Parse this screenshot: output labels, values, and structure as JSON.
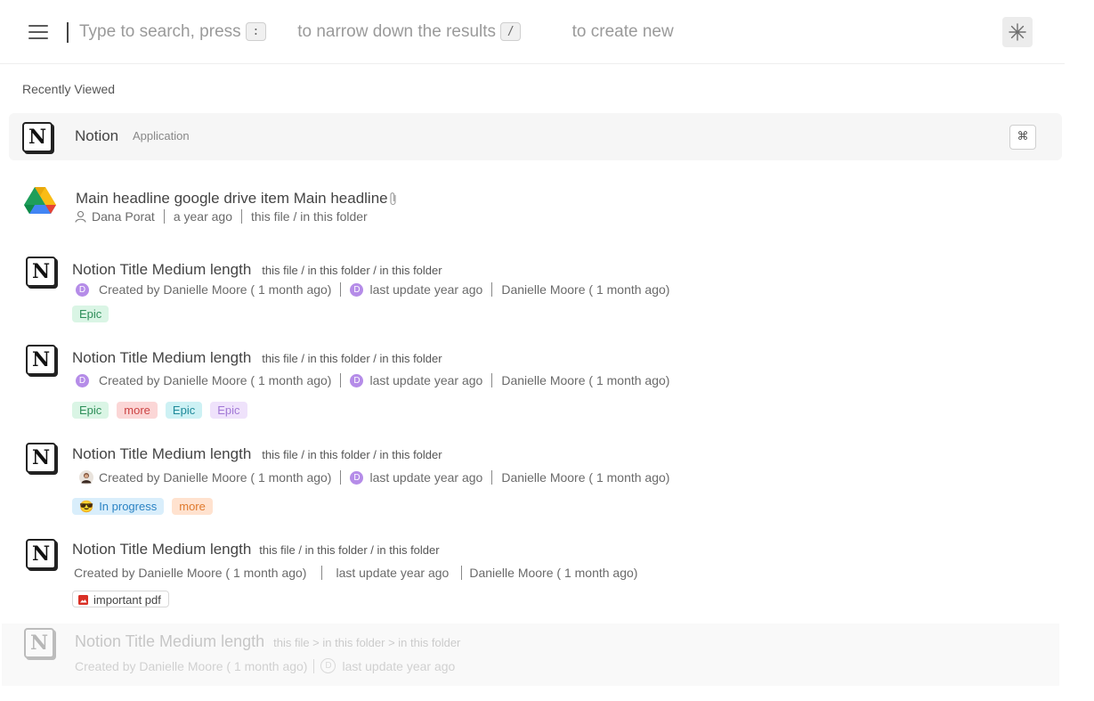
{
  "header": {
    "search_placeholder": "Type to search, press",
    "key_colon": ":",
    "narrow_text": "to narrow down the results",
    "key_slash": "/",
    "create_text": "to create new"
  },
  "recently_viewed_label": "Recently Viewed",
  "notion_app": {
    "title": "Notion",
    "type": "Application",
    "shortcut": "⌘"
  },
  "drive_item": {
    "title": "Main headline google drive item Main headline",
    "user": "Dana Porat",
    "time": "a year ago",
    "path": "this file / in this folder"
  },
  "notion_items": [
    {
      "title": "Notion Title Medium length",
      "path": "this file / in this folder / in this folder",
      "created_avatar": "D",
      "created": "Created by Danielle Moore ( 1 month ago)",
      "updated_avatar": "D",
      "updated": "last update year ago",
      "updated_by": "Danielle Moore ( 1 month ago)",
      "tags": [
        "Epic"
      ]
    },
    {
      "title": "Notion Title Medium length",
      "path": "this file / in this folder / in this folder",
      "created_avatar": "D",
      "created": "Created by Danielle Moore ( 1 month ago)",
      "updated_avatar": "D",
      "updated": "last update year ago",
      "updated_by": "Danielle Moore ( 1 month ago)",
      "tags": [
        "Epic",
        "more",
        "Epic",
        "Epic"
      ]
    },
    {
      "title": "Notion Title Medium length",
      "path": "this file / in this folder / in this folder",
      "created": "Created by Danielle Moore ( 1 month ago)",
      "updated_avatar": "D",
      "updated": "last update year ago",
      "updated_by": "Danielle Moore ( 1 month ago)",
      "tags": [
        "😎",
        "In progress",
        "more"
      ]
    },
    {
      "title": "Notion Title Medium length",
      "path": "this file / in this folder / in this folder",
      "created": "Created by Danielle Moore ( 1 month ago)",
      "updated": "last update year ago",
      "updated_by": "Danielle Moore ( 1 month ago)",
      "tags": [
        "important pdf"
      ]
    },
    {
      "title": "Notion Title Medium length",
      "path": "this file > in this folder > in this folder",
      "created": "Created by Danielle Moore ( 1 month ago)",
      "updated_avatar": "D",
      "updated": "last update year ago"
    }
  ],
  "icons": {
    "menu": "hamburger-icon",
    "spark": "asterisk-sparkle-icon",
    "notion": "notion-logo-icon",
    "drive": "google-drive-icon",
    "attachment": "paperclip-icon",
    "user": "person-icon",
    "pdf": "pdf-icon"
  },
  "colors": {
    "avatar_purple": "#b58ce8",
    "tag_green": "#daf5e5",
    "tag_red": "#fbd6d6",
    "tag_cyan": "#cdf1f4",
    "tag_purple": "#efe2fb",
    "tag_blue": "#d9eefb",
    "tag_orange": "#ffe2cf"
  }
}
